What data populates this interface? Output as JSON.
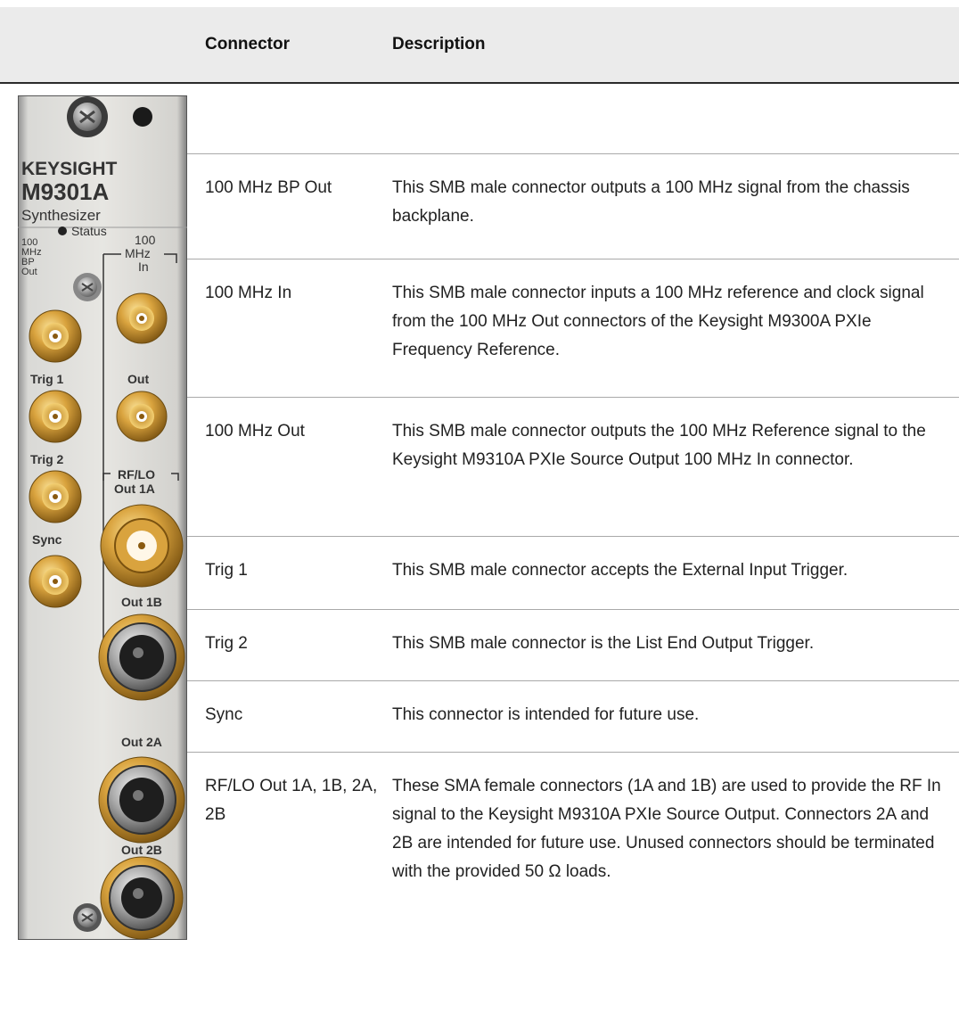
{
  "header": {
    "connector": "Connector",
    "description": "Description"
  },
  "panel": {
    "brand": "KEYSIGHT",
    "model": "M9301A",
    "subtitle": "Synthesizer",
    "labels": {
      "status": "Status",
      "bp1": "100",
      "bp2": "MHz",
      "bp3": "BP",
      "bp4": "Out",
      "in1": "100",
      "in2": "MHz",
      "in3": "In",
      "out": "Out",
      "trig1": "Trig 1",
      "trig2": "Trig 2",
      "sync": "Sync",
      "rflo1": "RF/LO",
      "rflo2": "Out 1A",
      "out1b": "Out 1B",
      "out2a": "Out 2A",
      "out2b": "Out 2B"
    }
  },
  "rows": [
    {
      "connector": "100 MHz BP Out",
      "description": "This SMB male connector outputs a 100 MHz signal from the chassis backplane."
    },
    {
      "connector": "100 MHz In",
      "description": "This SMB male connector inputs a 100 MHz reference and clock signal from the 100 MHz Out connectors of the Keysight M9300A PXIe Frequency Reference."
    },
    {
      "connector": "100 MHz Out",
      "description": "This SMB male connector outputs the 100 MHz Reference signal to the Keysight M9310A PXIe Source Output 100 MHz In connector."
    },
    {
      "connector": "Trig 1",
      "description": "This SMB male connector accepts the External Input Trigger."
    },
    {
      "connector": "Trig 2",
      "description": "This SMB male connector is the List End Output Trigger."
    },
    {
      "connector": "Sync",
      "description": "This connector is intended for future use."
    },
    {
      "connector": "RF/LO Out 1A, 1B, 2A, 2B",
      "description": "These SMA female connectors (1A and 1B) are used to provide the RF In signal to the Keysight M9310A PXIe Source Output. Connectors 2A and 2B are intended for future use. Unused connectors should be terminated with the provided 50 Ω loads."
    }
  ]
}
